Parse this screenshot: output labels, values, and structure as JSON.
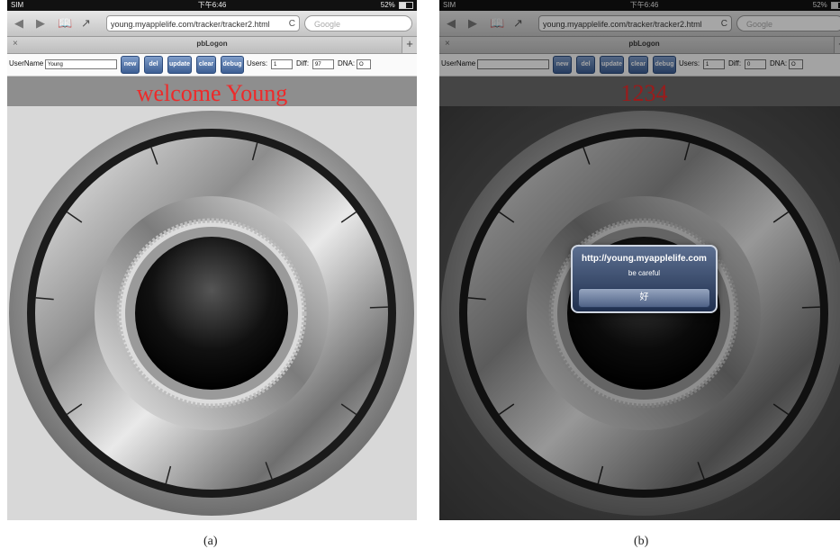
{
  "status": {
    "carrier": "SIM",
    "time": "下午6:46",
    "battery": "52%",
    "battery_level": 0.52
  },
  "browser": {
    "url": "young.myapplelife.com/tracker/tracker2.html",
    "search_placeholder": "Google",
    "tab_title": "pbLogon",
    "tab_close": "×",
    "tab_add": "+",
    "back": "◀",
    "forward": "▶",
    "reload": "C"
  },
  "form": {
    "username_label": "UserName",
    "users_label": "Users:",
    "diff_label": "Diff:",
    "dna_label": "DNA:",
    "buttons": [
      "new",
      "del",
      "update",
      "clear",
      "debug"
    ]
  },
  "panel_a": {
    "username_value": "Young",
    "users_value": "1",
    "diff_value": "97",
    "dna_value": "O",
    "message": "welcome Young"
  },
  "panel_b": {
    "username_value": "",
    "users_value": "1",
    "diff_value": "0",
    "dna_value": "O",
    "message": "1234",
    "alert": {
      "title": "http://young.myapplelife.com",
      "message": "be careful",
      "button": "好"
    }
  },
  "captions": {
    "a": "(a)",
    "b": "(b)"
  }
}
